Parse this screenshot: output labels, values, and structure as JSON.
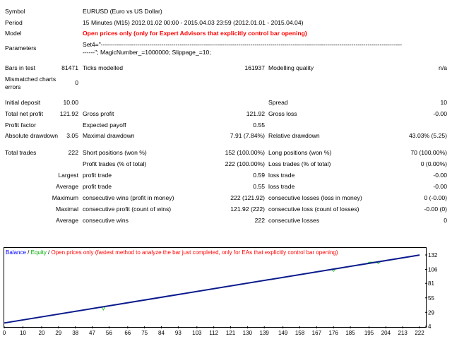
{
  "report": {
    "symbol": {
      "label": "Symbol",
      "value": "EURUSD (Euro vs US Dollar)"
    },
    "period": {
      "label": "Period",
      "value": "15 Minutes (M15) 2012.01.02 00:00 - 2015.04.03 23:59 (2012.01.01 - 2015.04.04)"
    },
    "model": {
      "label": "Model",
      "value": "Open prices only (only for Expert Advisors that explicitly control bar opening)"
    },
    "parameters": {
      "label": "Parameters",
      "line1": "Set4=\"-----------------------------------------------------------------------------------------------------------------------------------------------------",
      "line2": "------\"; MagicNumber_=1000000; Slippage_=10;"
    },
    "bars": {
      "label": "Bars in test",
      "value": "81471",
      "ticks_label": "Ticks modelled",
      "ticks_value": "161937",
      "quality_label": "Modelling quality",
      "quality_value": "n/a"
    },
    "mismatched": {
      "label": "Mismatched charts errors",
      "value": "0"
    },
    "deposit": {
      "label": "Initial deposit",
      "value": "10.00",
      "spread_label": "Spread",
      "spread_value": "10"
    },
    "net": {
      "label": "Total net profit",
      "value": "121.92",
      "gp_label": "Gross profit",
      "gp_value": "121.92",
      "gl_label": "Gross loss",
      "gl_value": "-0.00"
    },
    "pf": {
      "label": "Profit factor",
      "value": "",
      "ep_label": "Expected payoff",
      "ep_value": "0.55"
    },
    "dd": {
      "label": "Absolute drawdown",
      "value": "3.05",
      "max_label": "Maximal drawdown",
      "max_value": "7.91 (7.84%)",
      "rel_label": "Relative drawdown",
      "rel_value": "43.03% (5.25)"
    },
    "trades": {
      "label": "Total trades",
      "value": "222",
      "short_label": "Short positions (won %)",
      "short_value": "152 (100.00%)",
      "long_label": "Long positions (won %)",
      "long_value": "70 (100.00%)"
    },
    "pt": {
      "label": "Profit trades (% of total)",
      "value": "222 (100.00%)",
      "lt_label": "Loss trades (% of total)",
      "lt_value": "0 (0.00%)"
    },
    "largest": {
      "label": "Largest",
      "p_label": "profit trade",
      "p_value": "0.59",
      "l_label": "loss trade",
      "l_value": "-0.00"
    },
    "average": {
      "label": "Average",
      "p_label": "profit trade",
      "p_value": "0.55",
      "l_label": "loss trade",
      "l_value": "-0.00"
    },
    "maximum": {
      "label": "Maximum",
      "p_label": "consecutive wins (profit in money)",
      "p_value": "222 (121.92)",
      "l_label": "consecutive losses (loss in money)",
      "l_value": "0 (-0.00)"
    },
    "maximal": {
      "label": "Maximal",
      "p_label": "consecutive profit (count of wins)",
      "p_value": "121.92 (222)",
      "l_label": "consecutive loss (count of losses)",
      "l_value": "-0.00 (0)"
    },
    "average2": {
      "label": "Average",
      "p_label": "consecutive wins",
      "p_value": "222",
      "l_label": "consecutive losses",
      "l_value": "0"
    }
  },
  "legend": {
    "balance": "Balance",
    "sep1": " / ",
    "equity": "Equity",
    "sep2": " / ",
    "text": "Open prices only (fastest method to analyze the bar just completed, only for EAs that explicitly control bar opening)"
  },
  "colors": {
    "balance": "#0a1a8c",
    "equity": "#33cc33",
    "red": "#ff0000"
  },
  "chart_data": {
    "type": "line",
    "y_ticks": [
      "132",
      "106",
      "81",
      "55",
      "29",
      "4"
    ],
    "x_ticks": [
      "0",
      "10",
      "20",
      "29",
      "38",
      "47",
      "56",
      "66",
      "75",
      "84",
      "93",
      "103",
      "112",
      "121",
      "130",
      "139",
      "149",
      "158",
      "167",
      "176",
      "185",
      "195",
      "204",
      "213",
      "222"
    ],
    "ylim": [
      4,
      132
    ],
    "xlim": [
      0,
      225
    ],
    "series": [
      {
        "name": "Balance",
        "x": [
          0,
          222
        ],
        "y": [
          10,
          131.92
        ]
      },
      {
        "name": "Equity",
        "x": [
          0,
          37,
          38,
          39,
          52,
          53,
          54,
          175,
          176,
          177,
          194,
          195,
          199,
          200,
          201,
          222
        ],
        "y": [
          10,
          30.3,
          31.5,
          31.4,
          38.5,
          33.2,
          39.6,
          106.1,
          102.2,
          106.7,
          116.6,
          119.2,
          119.0,
          116.0,
          119.9,
          131.9
        ]
      }
    ]
  }
}
